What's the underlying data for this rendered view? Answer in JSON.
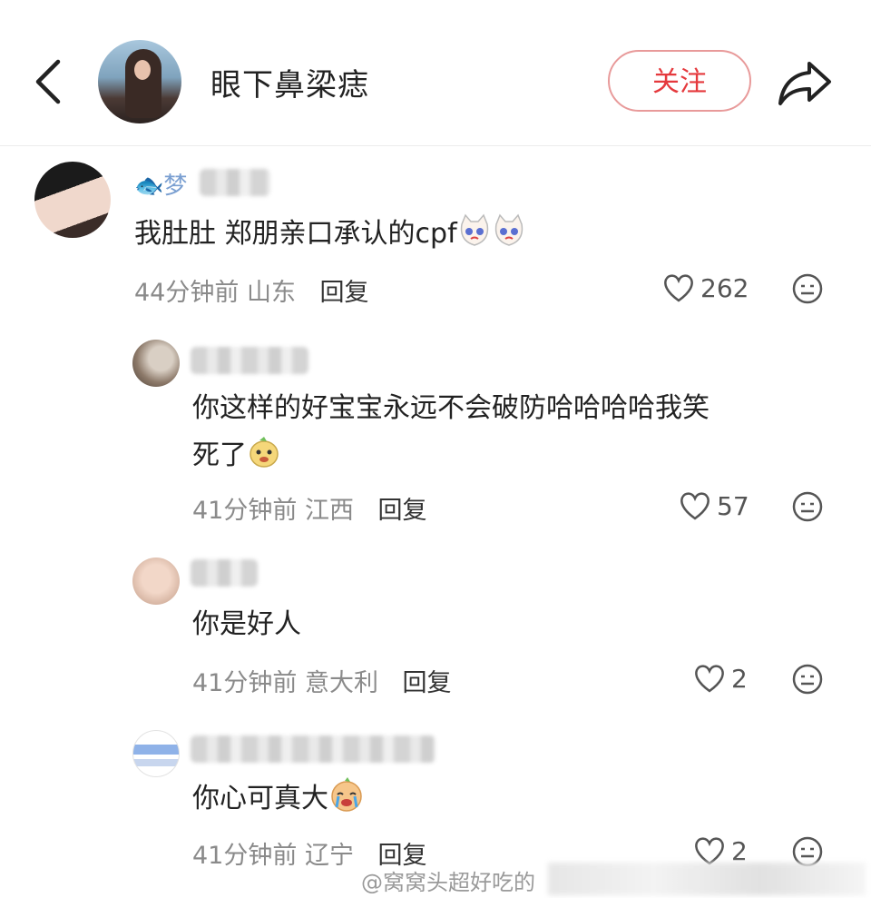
{
  "header": {
    "back_icon": "chevron-left-icon",
    "title": "眼下鼻梁痣",
    "follow_label": "关注",
    "share_icon": "share-arrow-icon"
  },
  "comments": [
    {
      "name_prefix": "🐟梦",
      "text": "我肚肚 郑朋亲口承认的cpf",
      "emoji": [
        "crying-cat-emoji",
        "crying-cat-emoji"
      ],
      "time": "44分钟前",
      "location": "山东",
      "reply_label": "回复",
      "likes": "262"
    },
    {
      "text_line1": "你这样的好宝宝永远不会破防哈哈哈哈我笑",
      "text_line2": "死了",
      "emoji": [
        "grinning-dog-emoji"
      ],
      "time": "41分钟前",
      "location": "江西",
      "reply_label": "回复",
      "likes": "57"
    },
    {
      "text": "你是好人",
      "time": "41分钟前",
      "location": "意大利",
      "reply_label": "回复",
      "likes": "2"
    },
    {
      "text": "你心可真大",
      "emoji": [
        "crying-face-emoji"
      ],
      "time": "41分钟前",
      "location": "辽宁",
      "reply_label": "回复",
      "likes": "2"
    }
  ],
  "watermark": "@窝窝头超好吃的",
  "colors": {
    "accent_red": "#e5393d",
    "follow_border": "#e89a9a",
    "meta_gray": "#8a8a8a",
    "name_blue": "#7a9fd1"
  }
}
